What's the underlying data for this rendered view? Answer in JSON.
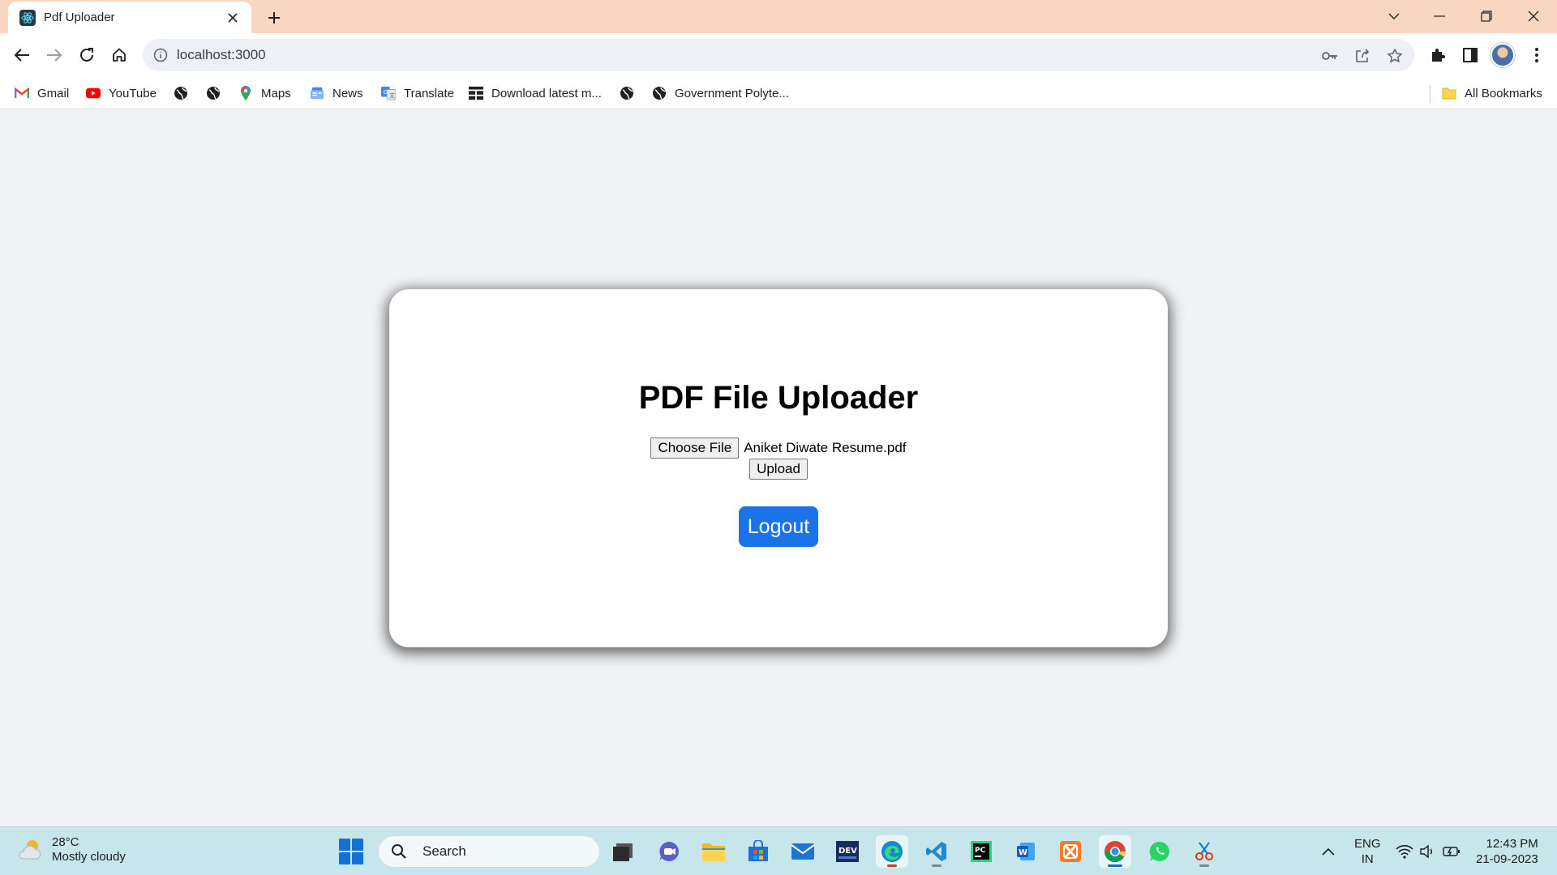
{
  "browser": {
    "tab_title": "Pdf Uploader",
    "url": "localhost:3000",
    "bookmarks": [
      {
        "label": "Gmail",
        "icon": "gmail-icon"
      },
      {
        "label": "YouTube",
        "icon": "youtube-icon"
      },
      {
        "label": "",
        "icon": "globe-icon"
      },
      {
        "label": "",
        "icon": "globe-icon"
      },
      {
        "label": "Maps",
        "icon": "maps-icon"
      },
      {
        "label": "News",
        "icon": "news-icon"
      },
      {
        "label": "Translate",
        "icon": "translate-icon"
      },
      {
        "label": "Download latest m...",
        "icon": "download-site-icon"
      },
      {
        "label": "",
        "icon": "globe-icon"
      },
      {
        "label": "Government Polyte...",
        "icon": "globe-icon"
      }
    ],
    "all_bookmarks": "All Bookmarks",
    "theme_color": "#f9d6c2"
  },
  "page": {
    "heading": "PDF File Uploader",
    "choose_file_label": "Choose File",
    "selected_file": "Aniket Diwate Resume.pdf",
    "upload_label": "Upload",
    "logout_label": "Logout",
    "accent_color": "#1a73e8"
  },
  "taskbar": {
    "temperature": "28°C",
    "weather": "Mostly cloudy",
    "search_label": "Search",
    "lang_top": "ENG",
    "lang_bottom": "IN",
    "time": "12:43 PM",
    "date": "21-09-2023",
    "apps": [
      "task-view-icon",
      "teams-icon",
      "file-explorer-icon",
      "store-icon",
      "mail-icon",
      "dev-tools-icon",
      "edge-icon",
      "vscode-icon",
      "pycharm-icon",
      "word-icon",
      "xampp-icon",
      "chrome-icon",
      "whatsapp-icon",
      "snipping-tool-icon"
    ]
  }
}
